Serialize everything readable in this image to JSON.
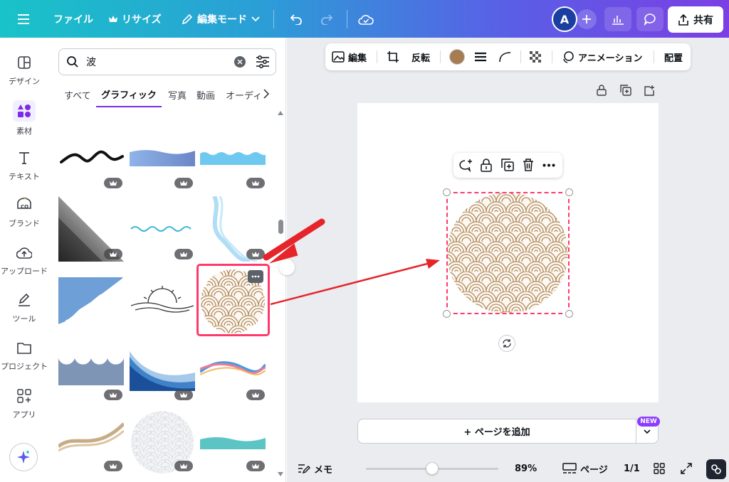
{
  "header": {
    "file": "ファイル",
    "resize": "リサイズ",
    "edit_mode": "編集モード",
    "avatar_initial": "A",
    "share": "共有"
  },
  "rail": {
    "items": [
      {
        "label": "デザイン",
        "icon": "layout-icon"
      },
      {
        "label": "素材",
        "icon": "elements-icon"
      },
      {
        "label": "テキスト",
        "icon": "text-icon"
      },
      {
        "label": "ブランド",
        "icon": "brand-icon"
      },
      {
        "label": "アップロード",
        "icon": "upload-icon"
      },
      {
        "label": "ツール",
        "icon": "draw-icon"
      },
      {
        "label": "プロジェクト",
        "icon": "folder-icon"
      },
      {
        "label": "アプリ",
        "icon": "apps-icon"
      }
    ]
  },
  "panel": {
    "search_value": "波",
    "tabs": [
      "すべて",
      "グラフィック",
      "写真",
      "動画",
      "オーディ"
    ],
    "active_tab": "グラフィック"
  },
  "toolbar": {
    "edit": "編集",
    "flip": "反転",
    "fill_color": "#a67c52",
    "animation": "アニメーション",
    "position": "配置"
  },
  "canvas": {
    "add_page": "+ ページを追加",
    "new_badge": "NEW"
  },
  "footer": {
    "notes": "メモ",
    "zoom": "89%",
    "zoom_fraction": 0.5,
    "pages_label": "ページ",
    "page_count": "1/1"
  },
  "colors": {
    "accent": "#7d2ae8",
    "highlight": "#ff3a6b",
    "arrow": "#e5252a",
    "pattern": "#a67c52"
  }
}
